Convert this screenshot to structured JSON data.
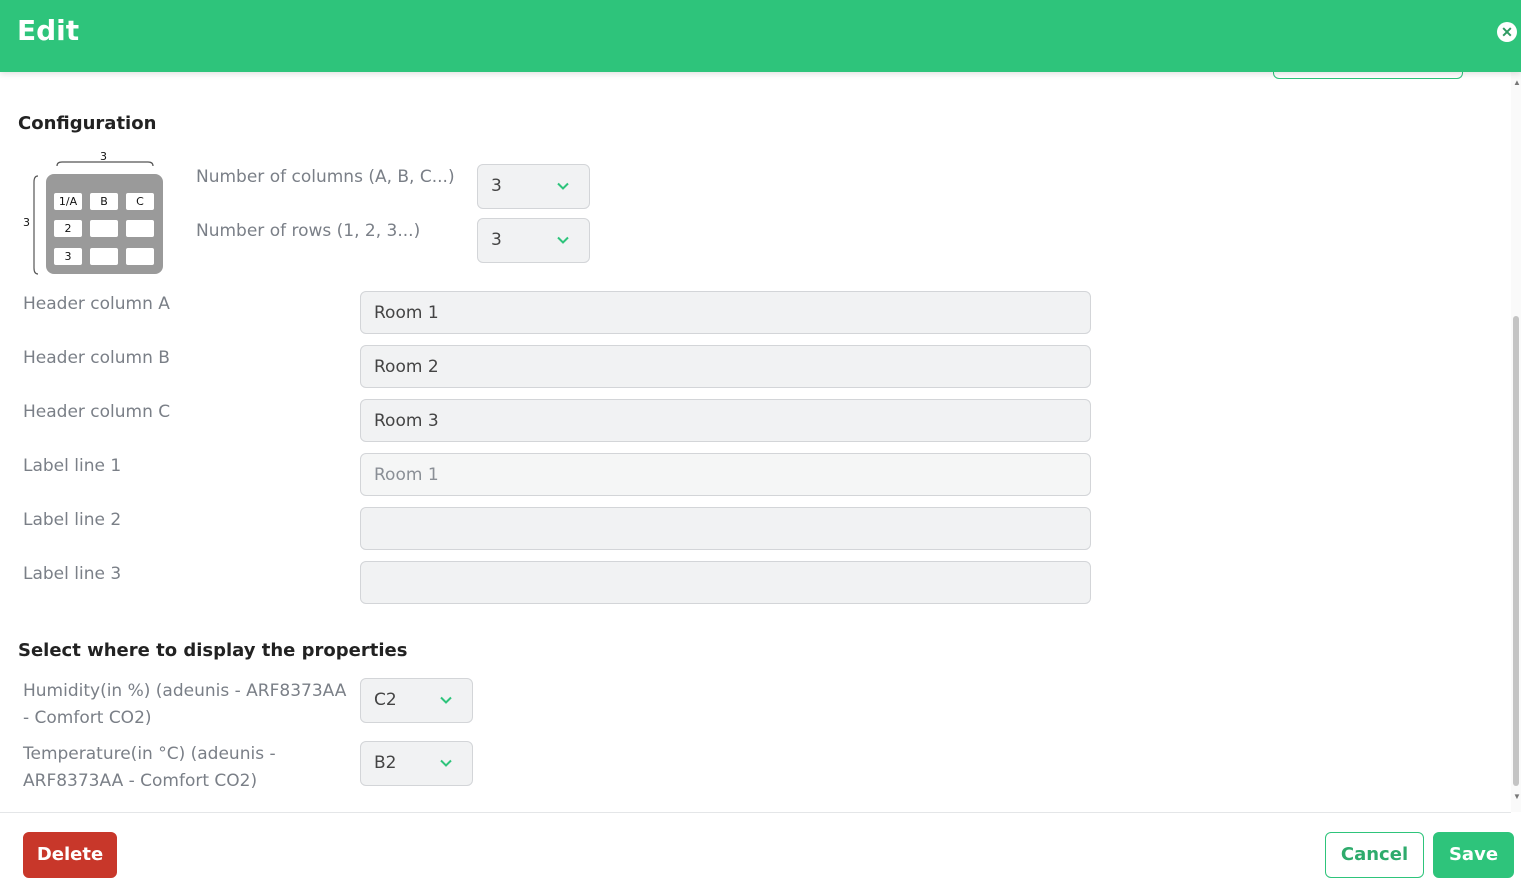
{
  "header": {
    "title": "Edit"
  },
  "configuration": {
    "title": "Configuration",
    "illustration": {
      "top_count": "3",
      "side_count": "3",
      "cells": [
        "1/A",
        "B",
        "C",
        "2",
        "",
        "",
        "3",
        "",
        ""
      ]
    },
    "columns": {
      "label": "Number of columns (A, B, C...)",
      "value": "3"
    },
    "rows": {
      "label": "Number of rows (1, 2, 3...)",
      "value": "3"
    },
    "fields": [
      {
        "label": "Header column A",
        "value": "Room 1",
        "placeholder": ""
      },
      {
        "label": "Header column B",
        "value": "Room 2",
        "placeholder": ""
      },
      {
        "label": "Header column C",
        "value": "Room 3",
        "placeholder": ""
      },
      {
        "label": "Label line 1",
        "value": "",
        "placeholder": "Room 1"
      },
      {
        "label": "Label line 2",
        "value": "",
        "placeholder": ""
      },
      {
        "label": "Label line 3",
        "value": "",
        "placeholder": ""
      }
    ]
  },
  "properties": {
    "title": "Select where to display the properties",
    "items": [
      {
        "label_line1": "Humidity(in %) (adeunis - ARF8373AA",
        "label_line2": "- Comfort CO2)",
        "value": "C2"
      },
      {
        "label_line1": "Temperature(in °C) (adeunis -",
        "label_line2": "ARF8373AA - Comfort CO2)",
        "value": "B2"
      }
    ]
  },
  "footer": {
    "delete_label": "Delete",
    "cancel_label": "Cancel",
    "save_label": "Save"
  },
  "colors": {
    "brand": "#2ec47b",
    "danger": "#c8372a"
  }
}
